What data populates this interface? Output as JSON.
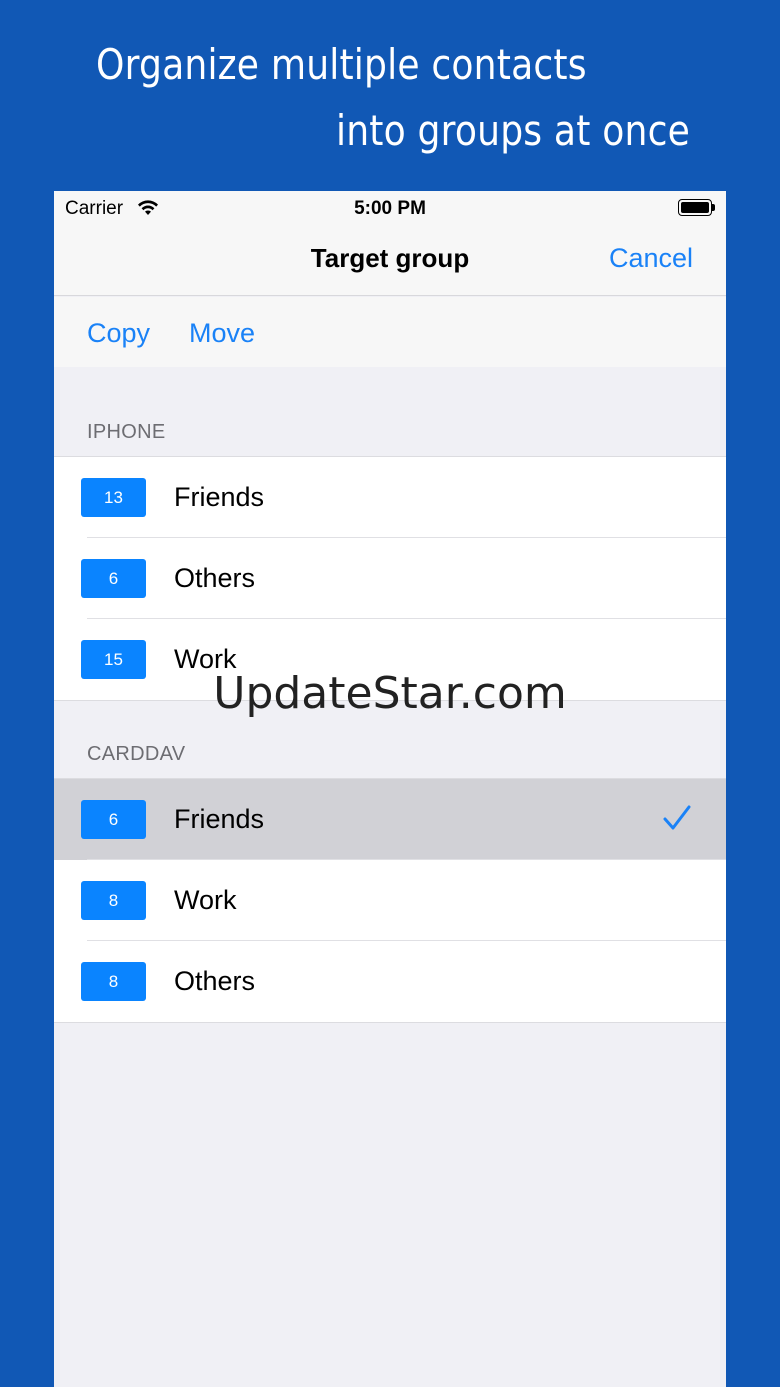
{
  "promo": {
    "line1": "Organize multiple contacts",
    "line2": "into groups at once"
  },
  "status_bar": {
    "carrier": "Carrier",
    "time": "5:00 PM"
  },
  "nav": {
    "title": "Target group",
    "cancel_label": "Cancel"
  },
  "actions": {
    "copy_label": "Copy",
    "move_label": "Move"
  },
  "sections": [
    {
      "header": "IPHONE",
      "rows": [
        {
          "count": "13",
          "name": "Friends",
          "selected": false
        },
        {
          "count": "6",
          "name": "Others",
          "selected": false
        },
        {
          "count": "15",
          "name": "Work",
          "selected": false
        }
      ]
    },
    {
      "header": "CARDDAV",
      "rows": [
        {
          "count": "6",
          "name": "Friends",
          "selected": true
        },
        {
          "count": "8",
          "name": "Work",
          "selected": false
        },
        {
          "count": "8",
          "name": "Others",
          "selected": false
        }
      ]
    }
  ],
  "watermark": "UpdateStar.com",
  "colors": {
    "background": "#1158b5",
    "accent": "#1a82f7",
    "badge": "#0a84ff",
    "selected_row": "#d1d1d6"
  }
}
